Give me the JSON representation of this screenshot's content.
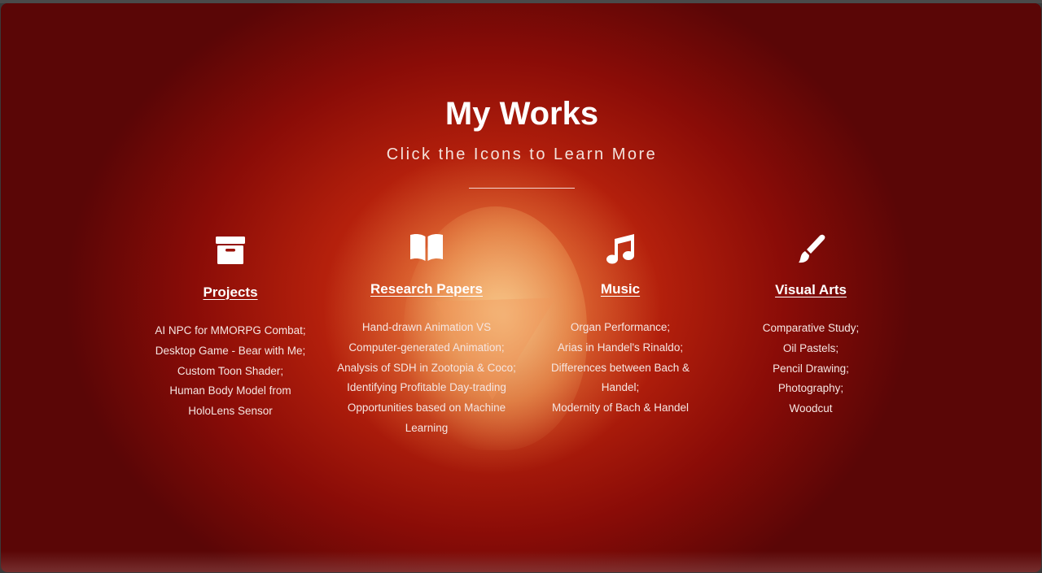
{
  "header": {
    "title": "My Works",
    "subtitle": "Click the Icons to Learn More"
  },
  "sections": [
    {
      "icon": "archive-box-icon",
      "heading": "Projects",
      "lines": [
        "AI NPC for MMORPG Combat;",
        "Desktop Game - Bear with Me;",
        "Custom Toon Shader;",
        "Human Body Model from",
        "HoloLens Sensor"
      ]
    },
    {
      "icon": "open-book-icon",
      "heading": "Research Papers",
      "lines": [
        "Hand-drawn Animation VS",
        "Computer-generated Animation;",
        "Analysis of SDH in Zootopia & Coco;",
        "Identifying Profitable Day-trading",
        "Opportunities based on Machine",
        "Learning"
      ]
    },
    {
      "icon": "music-notes-icon",
      "heading": "Music",
      "lines": [
        "Organ Performance;",
        "Arias in Handel's Rinaldo;",
        "Differences between Bach &",
        "Handel;",
        "Modernity of Bach & Handel"
      ]
    },
    {
      "icon": "paint-brush-icon",
      "heading": "Visual Arts",
      "lines": [
        "Comparative Study;",
        "Oil Pastels;",
        "Pencil Drawing;",
        "Photography;",
        "Woodcut"
      ]
    }
  ],
  "colors": {
    "background_center": "#d7381a",
    "background_edge": "#5a0606",
    "text": "#ffffff"
  }
}
